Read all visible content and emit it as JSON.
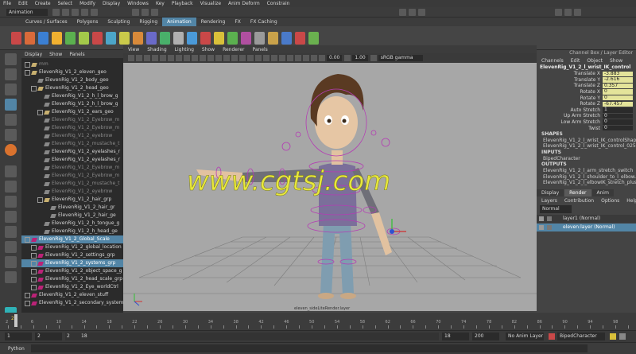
{
  "menu": [
    "File",
    "Edit",
    "Create",
    "Select",
    "Modify",
    "Display",
    "Windows",
    "Key",
    "Playback",
    "Visualize",
    "Anim Deform",
    "Constrain"
  ],
  "status": {
    "mode": "Animation"
  },
  "shelf": {
    "tabs": [
      "Curves / Surfaces",
      "Polygons",
      "Sculpting",
      "Rigging",
      "Animation",
      "Rendering",
      "FX",
      "FX Caching"
    ],
    "active_tab": "Animation",
    "icon_colors": [
      "#c94848",
      "#d96a3a",
      "#3b7fd2",
      "#f0b030",
      "#5bb04f",
      "#a3c94a",
      "#c94848",
      "#4ca6c9",
      "#c9c94a",
      "#d98a3a",
      "#6a6ac9",
      "#49b06a",
      "#b0b0b0",
      "#4a9ad9",
      "#c94848",
      "#d9c03a",
      "#5bb04f",
      "#b04fa0",
      "#9a9a9a",
      "#c9a24a",
      "#4a7ac9",
      "#c94848",
      "#6ab04f"
    ]
  },
  "outliner": {
    "menu": [
      "Display",
      "Show",
      "Panels"
    ],
    "items": [
      {
        "label": "mm",
        "depth": 0,
        "kind": "grp",
        "dim": true
      },
      {
        "label": "ElevenRig_V1_2_eleven_geo",
        "depth": 0,
        "kind": "grp"
      },
      {
        "label": "ElevenRig_V1_2_body_geo",
        "depth": 1,
        "kind": "geo"
      },
      {
        "label": "ElevenRig_V1_2_head_geo",
        "depth": 1,
        "kind": "grp"
      },
      {
        "label": "ElevenRig_V1_2_h_l_brow_g",
        "depth": 2,
        "kind": "geo"
      },
      {
        "label": "ElevenRig_V1_2_h_l_brow_g",
        "depth": 2,
        "kind": "geo"
      },
      {
        "label": "ElevenRig_V1_2_ears_geo",
        "depth": 2,
        "kind": "grp"
      },
      {
        "label": "ElevenRig_V1_2_Eyebrow_m",
        "depth": 2,
        "kind": "geo",
        "dim": true
      },
      {
        "label": "ElevenRig_V1_2_Eyebrow_m",
        "depth": 2,
        "kind": "geo",
        "dim": true
      },
      {
        "label": "ElevenRig_V1_2_eyebrow",
        "depth": 2,
        "kind": "geo",
        "dim": true
      },
      {
        "label": "ElevenRig_V1_2_mustache_t",
        "depth": 2,
        "kind": "geo",
        "dim": true
      },
      {
        "label": "ElevenRig_V1_2_eyelashes_r",
        "depth": 2,
        "kind": "geo"
      },
      {
        "label": "ElevenRig_V1_2_eyelashes_r",
        "depth": 2,
        "kind": "geo"
      },
      {
        "label": "ElevenRig_V1_2_Eyebrow_m",
        "depth": 2,
        "kind": "geo",
        "dim": true
      },
      {
        "label": "ElevenRig_V1_2_Eyebrow_m",
        "depth": 2,
        "kind": "geo",
        "dim": true
      },
      {
        "label": "ElevenRig_V1_2_mustache_t",
        "depth": 2,
        "kind": "geo",
        "dim": true
      },
      {
        "label": "ElevenRig_V1_2_eyebrow",
        "depth": 2,
        "kind": "geo",
        "dim": true
      },
      {
        "label": "ElevenRig_V1_2_hair_grp",
        "depth": 2,
        "kind": "grp"
      },
      {
        "label": "ElevenRig_V1_2_hair_gr",
        "depth": 3,
        "kind": "geo"
      },
      {
        "label": "ElevenRig_V1_2_hair_ge",
        "depth": 3,
        "kind": "geo"
      },
      {
        "label": "ElevenRig_V1_2_h_tongue_g",
        "depth": 2,
        "kind": "geo"
      },
      {
        "label": "ElevenRig_V1_2_h_head_ge",
        "depth": 2,
        "kind": "geo"
      },
      {
        "label": "ElevenRig_V1_2_Global_Scale",
        "depth": 0,
        "kind": "ctrl",
        "selected": true
      },
      {
        "label": "ElevenRig_V1_2_global_location",
        "depth": 1,
        "kind": "ctrl"
      },
      {
        "label": "ElevenRig_V1_2_settings_grp",
        "depth": 1,
        "kind": "ctrl"
      },
      {
        "label": "ElevenRig_V1_2_systems_grp",
        "depth": 1,
        "kind": "ctrl",
        "selected": true
      },
      {
        "label": "ElevenRig_V1_2_object_space_g",
        "depth": 1,
        "kind": "ctrl"
      },
      {
        "label": "ElevenRig_V1_2_head_scale_grp",
        "depth": 1,
        "kind": "ctrl"
      },
      {
        "label": "ElevenRig_V1_2_Eye_worldCtrl",
        "depth": 1,
        "kind": "ctrl"
      },
      {
        "label": "ElevenRig_V1_2_eleven_stuff",
        "depth": 0,
        "kind": "ctrl"
      },
      {
        "label": "ElevenRig_V1_2_secondary_system",
        "depth": 0,
        "kind": "ctrl"
      }
    ]
  },
  "viewport": {
    "menu": [
      "View",
      "Shading",
      "Lighting",
      "Show",
      "Renderer",
      "Panels"
    ],
    "val1": "0.00",
    "val2": "1.00",
    "color_space": "sRGB gamma",
    "watermark": "www.cgtsj.com",
    "label": "eleven_sideLiteRender.layer"
  },
  "channel_box": {
    "header": "Channel Box / Layer Editor",
    "menu": [
      "Channels",
      "Edit",
      "Object",
      "Show"
    ],
    "object": "ElevenRig_V1_2_l_wrist_IK_control",
    "channels": [
      {
        "name": "Translate X",
        "value": "-3.883",
        "keyed": true
      },
      {
        "name": "Translate Y",
        "value": "-2.616",
        "keyed": true
      },
      {
        "name": "Translate Z",
        "value": "0.357",
        "keyed": true
      },
      {
        "name": "Rotate X",
        "value": "0",
        "keyed": true
      },
      {
        "name": "Rotate Y",
        "value": "0",
        "keyed": true
      },
      {
        "name": "Rotate Z",
        "value": "-67.457",
        "keyed": true
      },
      {
        "name": "Auto Stretch",
        "value": "1",
        "keyed": false
      },
      {
        "name": "Up Arm Stretch",
        "value": "0",
        "keyed": false
      },
      {
        "name": "Low Arm Stretch",
        "value": "0",
        "keyed": false
      },
      {
        "name": "Twist",
        "value": "0",
        "keyed": false
      }
    ],
    "shapes_title": "SHAPES",
    "shapes": [
      "ElevenRig_V1_2_l_wrist_IK_controlShape",
      "ElevenRig_V1_2_l_wrist_IK_control_025..."
    ],
    "inputs_title": "INPUTS",
    "inputs": [
      "BipedCharacter"
    ],
    "outputs_title": "OUTPUTS",
    "outputs": [
      "ElevenRig_V1_2_l_arm_stretch_switch",
      "ElevenRig_V1_2_l_shoulder_to_l_elbow...",
      "ElevenRig_V1_2_l_elbowIK_stretch_plus"
    ]
  },
  "layers": {
    "tabs": [
      "Display",
      "Render",
      "Anim"
    ],
    "active_tab": "Render",
    "menu": [
      "Layers",
      "Contribution",
      "Options",
      "Help"
    ],
    "mode": "Normal",
    "items": [
      {
        "name": "layer1 (Normal)",
        "selected": false
      },
      {
        "name": "eleven:layer (Normal)",
        "selected": true
      }
    ]
  },
  "timeline": {
    "ticks": [
      "2",
      "4",
      "6",
      "8",
      "10",
      "12",
      "14",
      "16",
      "18",
      "20",
      "22",
      "24",
      "26",
      "28",
      "30",
      "32",
      "34",
      "36",
      "38",
      "40",
      "42",
      "44",
      "46",
      "48",
      "50",
      "52",
      "54",
      "56",
      "58",
      "60",
      "62",
      "64",
      "66",
      "68",
      "70",
      "72",
      "74",
      "76",
      "78",
      "80",
      "82",
      "84",
      "86",
      "88",
      "90",
      "92",
      "94",
      "96",
      "98",
      "100"
    ],
    "current": "2"
  },
  "range": {
    "start": "1",
    "anim_start": "2",
    "range_start": "2",
    "range_end": "18",
    "anim_end": "18",
    "end": "200",
    "anim_layer": "No Anim Layer",
    "character": "BipedCharacter"
  },
  "cmdline": {
    "label": "Python"
  }
}
